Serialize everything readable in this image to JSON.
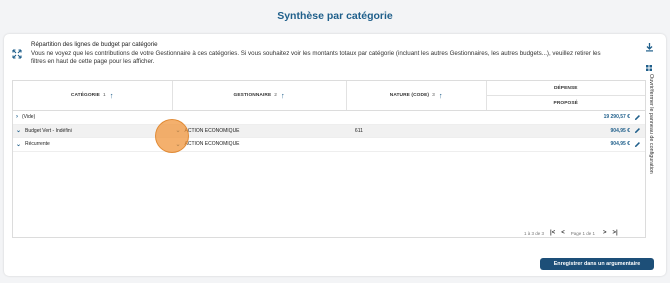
{
  "page": {
    "title": "Synthèse par catégorie"
  },
  "intro": {
    "heading": "Répartition des lignes de budget par catégorie",
    "line1": "Vous ne voyez que les contributions de votre Gestionnaire à ces catégories. Si vous souhaitez voir les montants totaux par catégorie (incluant les autres Gestionnaires, les autres budgets...), veuillez retirer les",
    "line2": "filtres en haut de cette page pour les afficher."
  },
  "table": {
    "columns": {
      "categorie": {
        "label": "CATÉGORIE",
        "sort": "1"
      },
      "gestionnaire": {
        "label": "GESTIONNAIRE",
        "sort": "2"
      },
      "nature": {
        "label": "NATURE (CODE)",
        "sort": "3"
      },
      "depense": {
        "label": "DÉPENSE",
        "sub": "PROPOSÉ"
      }
    },
    "rows": [
      {
        "chevron": "›",
        "categorie": "(Vide)",
        "gestionnaire": "",
        "nature": "",
        "amount": "19 290,57 €"
      },
      {
        "chevron": "⌄",
        "categorie": "Budget Vert - Indéfini",
        "gestionnaire": "ACTION ECONOMIQUE",
        "gest_chevron": "⌄",
        "nature": "611",
        "amount": "904,95 €"
      },
      {
        "chevron": "⌄",
        "categorie": "Récurrente",
        "gestionnaire": "ACTION ECONOMIQUE",
        "gest_chevron": "⌄",
        "nature": "",
        "amount": "904,95 €"
      }
    ]
  },
  "pagination": {
    "range": "1 à 3 de 3",
    "page_label": "Page 1 de 1",
    "first": "|<",
    "prev": "<",
    "next": ">",
    "last": ">|"
  },
  "side_panel": {
    "label": "Ouvrir/fermer le panneau de configuration"
  },
  "actions": {
    "save_label": "Enregistrer dans un argumentaire"
  },
  "colors": {
    "primary": "#1f5f8b",
    "button": "#1d4f78",
    "cursor": "#f0963c"
  }
}
